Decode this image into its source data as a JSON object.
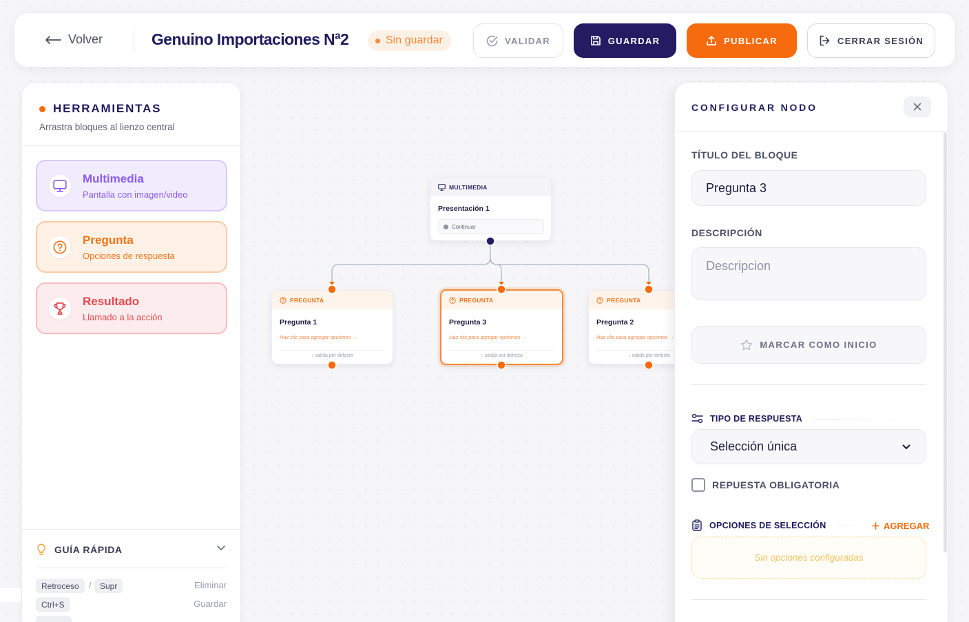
{
  "header": {
    "back_label": "Volver",
    "project_title": "Genuino Importaciones Nª2",
    "status_badge": "Sin guardar",
    "validate_label": "VALIDAR",
    "save_label": "GUARDAR",
    "publish_label": "PUBLICAR",
    "logout_label": "CERRAR SESIÓN"
  },
  "tools_panel": {
    "title": "HERRAMIENTAS",
    "subtitle": "Arrastra bloques al lienzo central",
    "tools": [
      {
        "name": "Multimedia",
        "description": "Pantalla con imagen/video",
        "icon": "monitor-icon"
      },
      {
        "name": "Pregunta",
        "description": "Opciones de respuesta",
        "icon": "question-circle-icon"
      },
      {
        "name": "Resultado",
        "description": "Llamado a la acción",
        "icon": "trophy-icon"
      }
    ]
  },
  "quick_guide": {
    "title": "GUÍA RÁPIDA",
    "shortcuts": [
      {
        "keys": [
          "Retroceso",
          "Supr"
        ],
        "separator": "/",
        "action": "Eliminar"
      },
      {
        "keys": [
          "Ctrl+S"
        ],
        "action": "Guardar"
      }
    ]
  },
  "canvas": {
    "nodes": [
      {
        "type_label": "MULTIMEDIA",
        "title": "Presentación 1",
        "button_label": "Continuar"
      },
      {
        "type_label": "PREGUNTA",
        "title": "Pregunta 1",
        "hint": "Haz clic para agregar opciones →",
        "footer": "↓ salida por defecto"
      },
      {
        "type_label": "PREGUNTA",
        "title": "Pregunta 3",
        "hint": "Haz clic para agregar opciones →",
        "footer": "↓ salida por defecto",
        "selected": true
      },
      {
        "type_label": "PREGUNTA",
        "title": "Pregunta 2",
        "hint": "Haz clic para agregar opciones →",
        "footer": "↓ salida por defecto"
      }
    ]
  },
  "config_panel": {
    "title": "CONFIGURAR NODO",
    "block_title_label": "TÍTULO DEL BLOQUE",
    "block_title_value": "Pregunta 3",
    "description_label": "DESCRIPCIÓN",
    "description_placeholder": "Descripcion",
    "mark_start_label": "MARCAR COMO INICIO",
    "response_type_label": "TIPO DE RESPUESTA",
    "response_type_value": "Selección única",
    "required_label": "REPUESTA OBLIGATORIA",
    "required_checked": false,
    "options_label": "OPCIONES DE SELECCIÓN",
    "add_label": "AGREGAR",
    "empty_options": "Sin opciones configuradas"
  },
  "colors": {
    "brand_dark": "#241b63",
    "brand_orange": "#f56b0d",
    "multimedia": "#8b5cf0",
    "question": "#f07417",
    "result": "#e5484d"
  }
}
